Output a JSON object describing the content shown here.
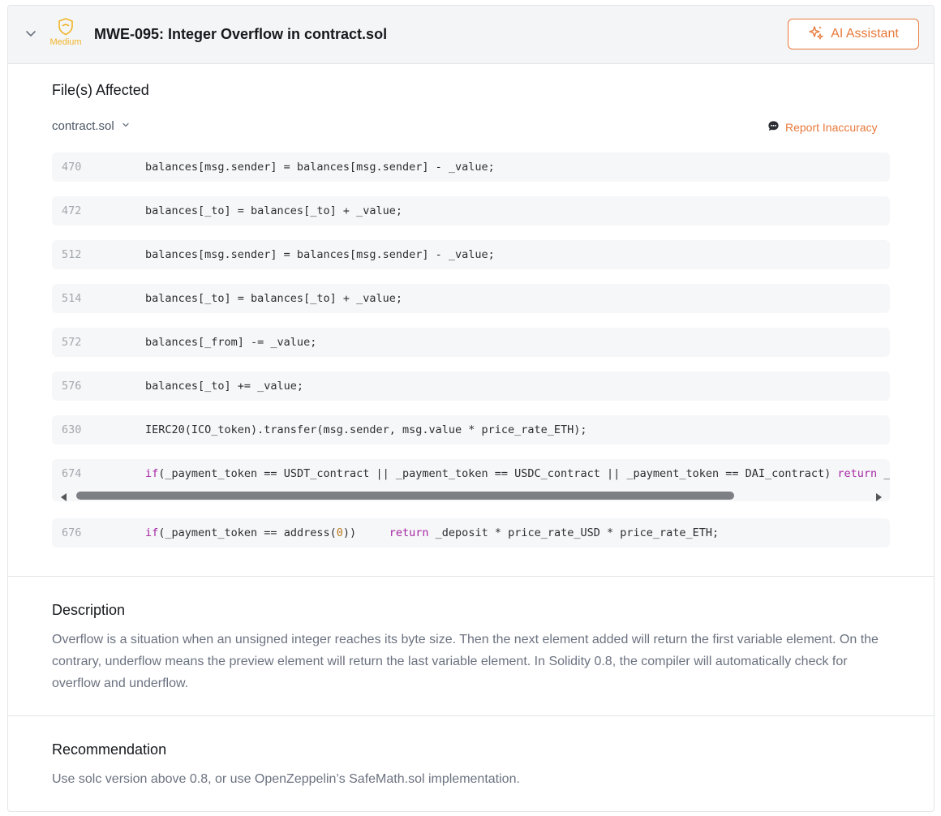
{
  "header": {
    "severity_label": "Medium",
    "title": "MWE-095: Integer Overflow in contract.sol",
    "ai_button_label": "AI Assistant",
    "collapse_icon": "chevron-down-icon",
    "severity_icon": "shield-icon",
    "ai_icon": "sparkles-icon"
  },
  "files": {
    "heading": "File(s) Affected",
    "selected_file": "contract.sol",
    "report_label": "Report Inaccuracy",
    "report_icon": "chat-bubble-icon"
  },
  "code_lines": [
    {
      "line": "470",
      "code": "balances[msg.sender] = balances[msg.sender] - _value;"
    },
    {
      "line": "472",
      "code": "balances[_to] = balances[_to] + _value;"
    },
    {
      "line": "512",
      "code": "balances[msg.sender] = balances[msg.sender] - _value;"
    },
    {
      "line": "514",
      "code": "balances[_to] = balances[_to] + _value;"
    },
    {
      "line": "572",
      "code": "balances[_from] -= _value;"
    },
    {
      "line": "576",
      "code": "balances[_to] += _value;"
    },
    {
      "line": "630",
      "code": "IERC20(ICO_token).transfer(msg.sender, msg.value * price_rate_ETH);"
    },
    {
      "line": "674",
      "kw1": "if",
      "code_a": "(_payment_token == USDT_contract || _payment_token == USDC_contract || _payment_token == DAI_contract) ",
      "kw2": "return",
      "code_b": " _d"
    },
    {
      "line": "676",
      "kw1": "if",
      "code_a": "(_payment_token == address(",
      "num": "0",
      "code_b": "))     ",
      "kw2": "return",
      "code_c": " _deposit * price_rate_USD * price_rate_ETH;"
    }
  ],
  "description": {
    "heading": "Description",
    "text": "Overflow is a situation when an unsigned integer reaches its byte size. Then the next element added will return the first variable element. On the contrary, underflow means the preview element will return the last variable element. In Solidity 0.8, the compiler will automatically check for overflow and underflow."
  },
  "recommendation": {
    "heading": "Recommendation",
    "text": "Use solc version above 0.8, or use OpenZeppelin’s SafeMath.sol implementation."
  },
  "colors": {
    "accent": "#e8793a",
    "severity_medium": "#f0b429",
    "keyword": "#a626a4"
  }
}
